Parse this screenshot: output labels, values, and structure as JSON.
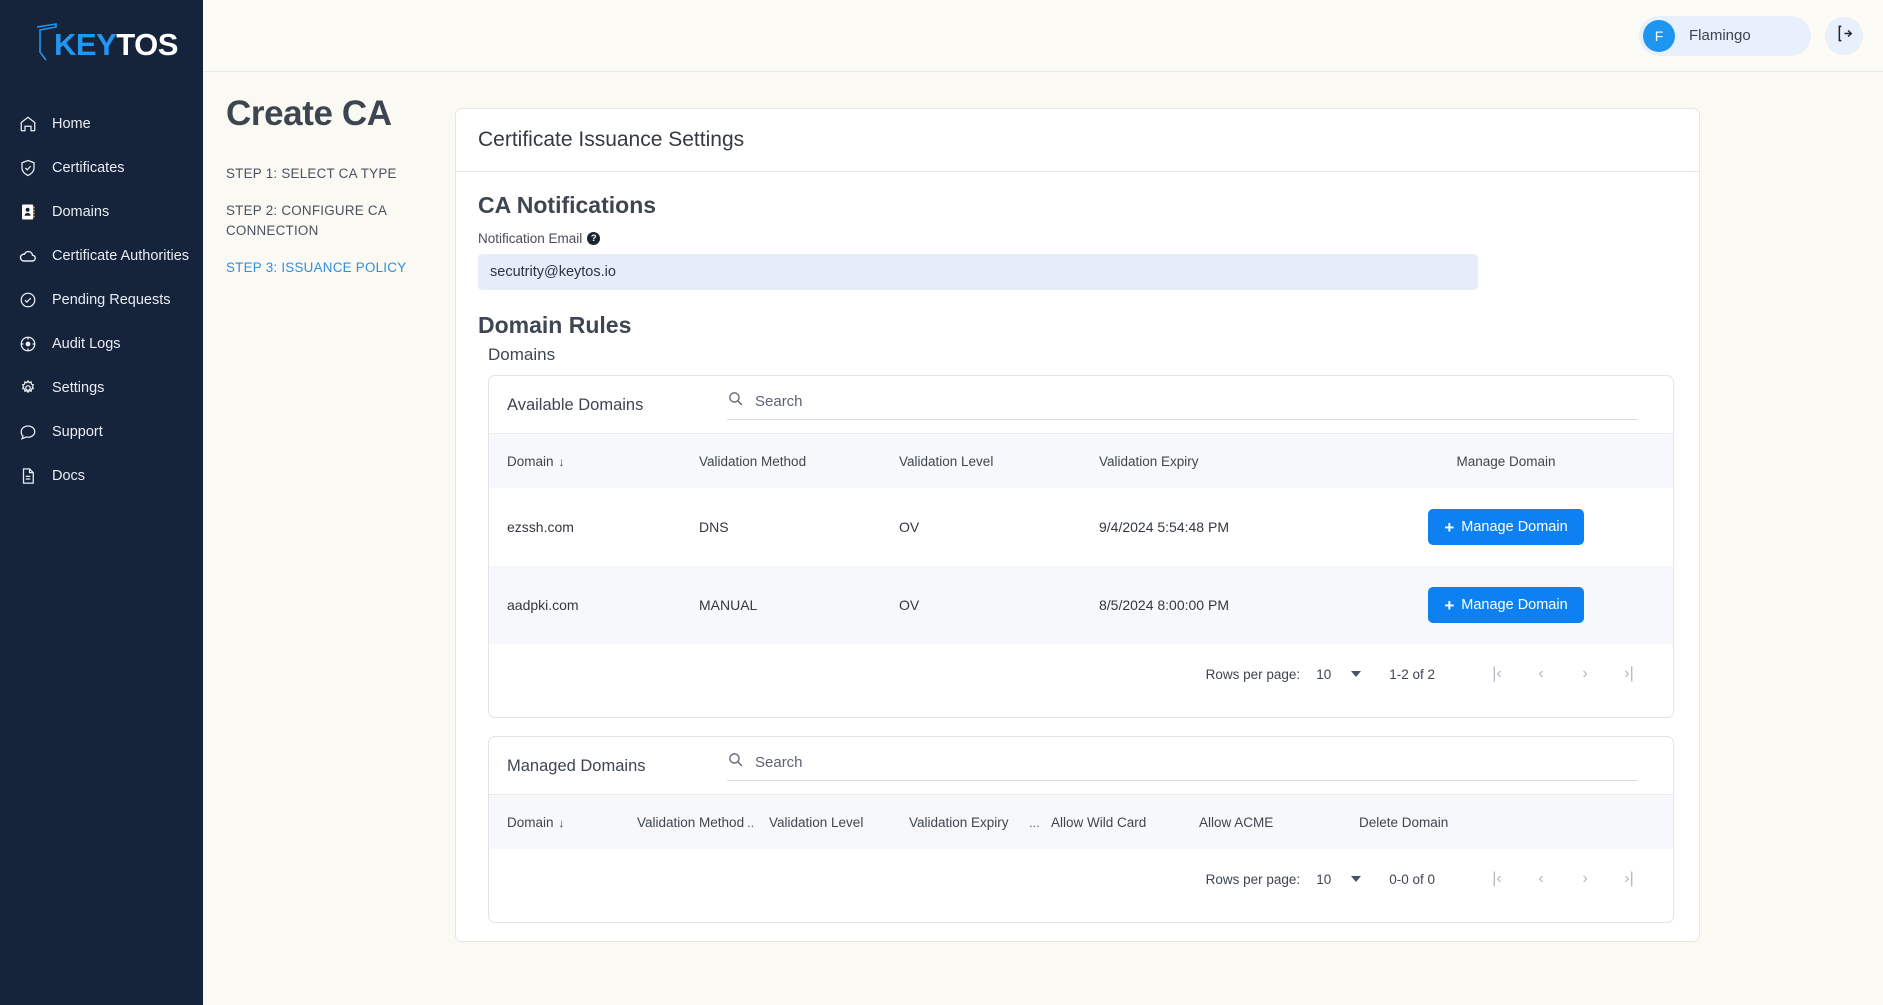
{
  "brand": {
    "name_part1": "KEY",
    "name_part2": "TOS",
    "accent": "#2196f3"
  },
  "sidebar": {
    "items": [
      {
        "label": "Home",
        "icon": "home-icon"
      },
      {
        "label": "Certificates",
        "icon": "shield-check-icon"
      },
      {
        "label": "Domains",
        "icon": "contact-book-icon"
      },
      {
        "label": "Certificate Authorities",
        "icon": "cloud-icon"
      },
      {
        "label": "Pending Requests",
        "icon": "check-circle-icon"
      },
      {
        "label": "Audit Logs",
        "icon": "compass-icon"
      },
      {
        "label": "Settings",
        "icon": "gear-icon"
      },
      {
        "label": "Support",
        "icon": "chat-bubble-icon"
      },
      {
        "label": "Docs",
        "icon": "document-icon"
      }
    ]
  },
  "topbar": {
    "user_initial": "F",
    "user_name": "Flamingo",
    "logout_icon": "logout-icon"
  },
  "page": {
    "title": "Create CA",
    "steps": [
      {
        "label": "STEP 1: SELECT CA TYPE",
        "active": false
      },
      {
        "label": "STEP 2: CONFIGURE CA CONNECTION",
        "active": false
      },
      {
        "label": "STEP 3: ISSUANCE POLICY",
        "active": true
      }
    ]
  },
  "card": {
    "header": "Certificate Issuance Settings",
    "notifications": {
      "section_title": "CA Notifications",
      "field_label": "Notification Email",
      "help_glyph": "?",
      "email_value": "secutrity@keytos.io"
    },
    "domain_rules": {
      "section_title": "Domain Rules",
      "sub_title": "Domains"
    }
  },
  "available_domains": {
    "panel_title": "Available Domains",
    "search_placeholder": "Search",
    "search_value": "",
    "columns": [
      "Domain",
      "Validation Method",
      "Validation Level",
      "Validation Expiry",
      "Manage Domain"
    ],
    "sort_column": "Domain",
    "sort_arrow": "↓",
    "rows": [
      {
        "domain": "ezssh.com",
        "validation_method": "DNS",
        "validation_level": "OV",
        "validation_expiry": "9/4/2024 5:54:48 PM",
        "action_label": "Manage Domain"
      },
      {
        "domain": "aadpki.com",
        "validation_method": "MANUAL",
        "validation_level": "OV",
        "validation_expiry": "8/5/2024 8:00:00 PM",
        "action_label": "Manage Domain"
      }
    ],
    "paginator": {
      "rows_per_page_label": "Rows per page:",
      "rows_per_page_value": "10",
      "range": "1-2 of 2",
      "first": "|‹",
      "prev": "‹",
      "next": "›",
      "last": "›|"
    }
  },
  "managed_domains": {
    "panel_title": "Managed Domains",
    "search_placeholder": "Search",
    "search_value": "",
    "columns": [
      "Domain",
      "Validation Method",
      "..",
      "Validation Level",
      "Validation Expiry",
      "...",
      "Allow Wild Card",
      "Allow ACME",
      "Delete Domain"
    ],
    "sort_column": "Domain",
    "sort_arrow": "↓",
    "rows": [],
    "paginator": {
      "rows_per_page_label": "Rows per page:",
      "rows_per_page_value": "10",
      "range": "0-0 of 0",
      "first": "|‹",
      "prev": "‹",
      "next": "›",
      "last": "›|"
    }
  }
}
